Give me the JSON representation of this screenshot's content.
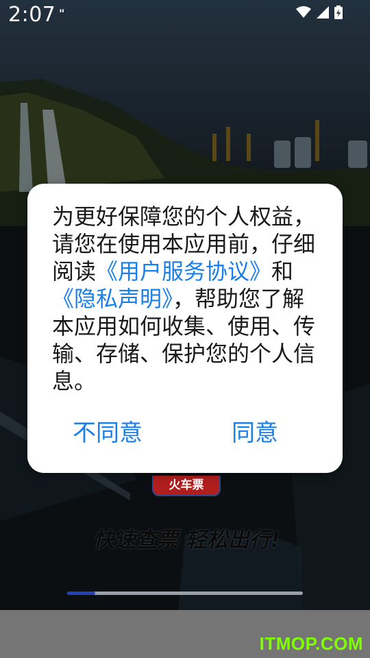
{
  "status_bar": {
    "time": "2:07",
    "notification_glyph": "\"",
    "icons": [
      "wifi-icon",
      "signal-icon",
      "battery-charging-icon"
    ]
  },
  "splash": {
    "badge": "火车票",
    "slogan": "快速查票 轻松出行!",
    "loading_progress": 0.12
  },
  "dialog": {
    "text_before": "为更好保障您的个人权益，请您在使用本应用前，仔细阅读",
    "link_terms": "《用户服务协议》",
    "text_and": "和",
    "link_privacy": "《隐私声明》",
    "text_after": "，帮助您了解本应用如何收集、使用、传输、存储、保护您的个人信息。",
    "disagree_label": "不同意",
    "agree_label": "同意"
  },
  "watermark": "ITMOP.COM",
  "colors": {
    "accent": "#1a7fe8",
    "progress": "#2442b8",
    "watermark": "#7fff00"
  }
}
